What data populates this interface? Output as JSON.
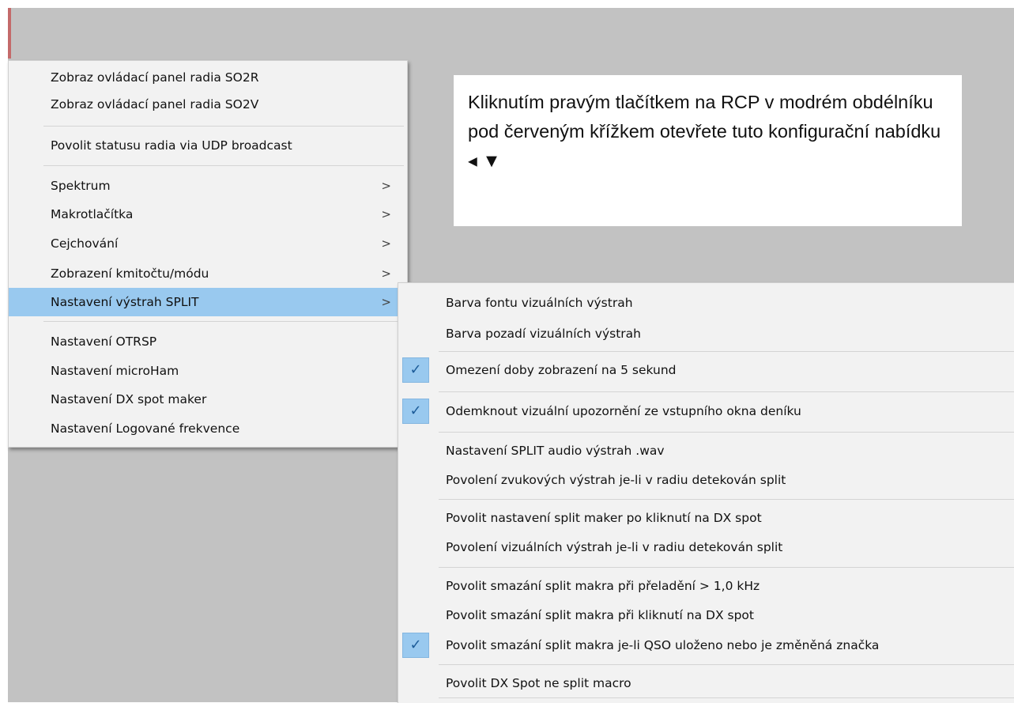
{
  "main_menu": {
    "items": [
      {
        "label": "Zobraz ovládací panel radia SO2R"
      },
      {
        "label": "Zobraz ovládací panel radia SO2V"
      },
      {
        "label": "Povolit statusu radia via UDP broadcast"
      },
      {
        "label": "Spektrum",
        "arrow": ">"
      },
      {
        "label": "Makrotlačítka",
        "arrow": ">"
      },
      {
        "label": "Cejchování",
        "arrow": ">"
      },
      {
        "label": "Zobrazení kmitočtu/módu",
        "arrow": ">"
      },
      {
        "label": "Nastavení výstrah SPLIT",
        "arrow": ">",
        "highlighted": true
      },
      {
        "label": "Nastavení OTRSP"
      },
      {
        "label": "Nastavení microHam"
      },
      {
        "label": "Nastavení DX spot maker"
      },
      {
        "label": "Nastavení Logované frekvence"
      }
    ]
  },
  "submenu": {
    "check_glyph": "✓",
    "items": [
      {
        "label": "Barva fontu vizuálních výstrah",
        "checked": false
      },
      {
        "label": "Barva pozadí vizuálních výstrah",
        "checked": false
      },
      {
        "label": "Omezení doby zobrazení na 5 sekund",
        "checked": true
      },
      {
        "label": "Odemknout vizuální upozornění ze vstupního okna deníku",
        "checked": true
      },
      {
        "label": "Nastavení SPLIT audio výstrah .wav",
        "checked": false
      },
      {
        "label": "Povolení zvukových výstrah je-li v radiu detekován split",
        "checked": false
      },
      {
        "label": "Povolit nastavení split maker po kliknutí na DX spot",
        "checked": false
      },
      {
        "label": "Povolení vizuálních výstrah je-li v radiu detekován split",
        "checked": false
      },
      {
        "label": "Povolit smazání split makra při přeladění > 1,0 kHz",
        "checked": false
      },
      {
        "label": "Povolit smazání split makra při kliknutí na DX spot",
        "checked": false
      },
      {
        "label": "Povolit smazání split makra je-li QSO uloženo nebo je změněná značka",
        "checked": true
      },
      {
        "label": "Povolit DX Spot ne split macro",
        "checked": false
      }
    ]
  },
  "note": {
    "text": "Kliknutím pravým tlačítkem na RCP v modrém obdélníku pod červeným křížkem otevřete tuto konfigurační nabídku ◂ ▼"
  },
  "colors": {
    "highlight": "#99c9ef",
    "menu_bg": "#f2f2f2",
    "app_bg": "#c2c2c2"
  }
}
